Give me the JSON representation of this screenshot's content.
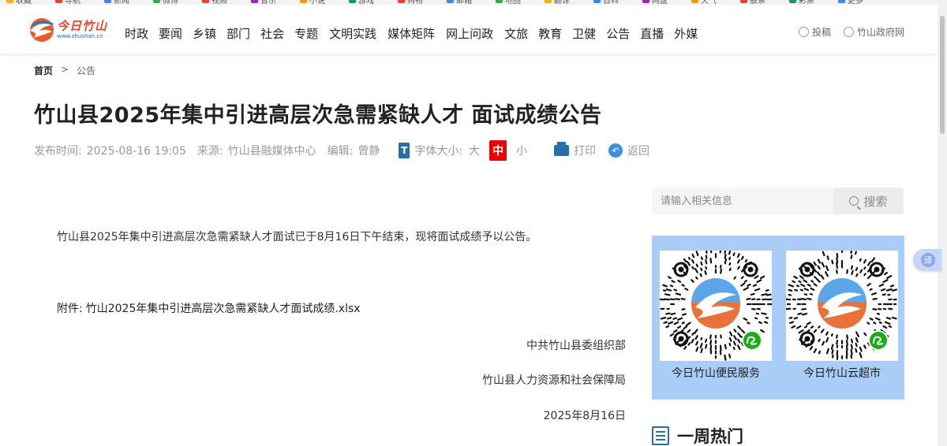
{
  "bookmarks": [
    "收藏",
    "导航",
    "新闻",
    "微博",
    "视频",
    "音乐",
    "小说",
    "游戏",
    "购物",
    "邮箱",
    "地图",
    "翻译",
    "百科",
    "网盘",
    "天气",
    "股票",
    "彩票",
    "更多"
  ],
  "header": {
    "logo_cn": "今日竹山",
    "logo_url": "www.zhushan.cn",
    "nav": [
      "时政",
      "要闻",
      "乡镇",
      "部门",
      "社会",
      "专题",
      "文明实践",
      "媒体矩阵",
      "网上问政",
      "文旅",
      "教育",
      "卫健",
      "公告",
      "直播",
      "外媒"
    ],
    "right_links": {
      "submit": "投稿",
      "gov": "竹山政府网"
    }
  },
  "breadcrumb": {
    "home": "首页",
    "sep": ">",
    "current": "公告"
  },
  "article": {
    "title": "竹山县2025年集中引进高层次急需紧缺人才 面试成绩公告",
    "publish_label": "发布时间:",
    "publish_time": "2025-08-16 19:05",
    "source_label": "来源:",
    "source": "竹山县融媒体中心",
    "editor_label": "编辑:",
    "editor": "曾静",
    "font_size_label": "字体大小:",
    "font_sizes": {
      "large": "大",
      "medium": "中",
      "small": "小"
    },
    "print": "打印",
    "back": "返回",
    "para1": "竹山县2025年集中引进高层次急需紧缺人才面试已于8月16日下午结束，现将面试成绩予以公告。",
    "attachment_label": "附件:",
    "attachment_name": "竹山2025年集中引进高层次急需紧缺人才面试成绩.xlsx",
    "sign1": "中共竹山县委组织部",
    "sign2": "竹山县人力资源和社会保障局",
    "sign_date": "2025年8月16日"
  },
  "sidebar": {
    "search_placeholder": "请输入相关信息",
    "search_button": "搜索",
    "qr_codes": [
      {
        "label": "今日竹山便民服务"
      },
      {
        "label": "今日竹山云超市"
      }
    ],
    "hot_title": "一周热门"
  },
  "translate": "译",
  "colors": {
    "accent_blue": "#2a6ea8",
    "active_red": "#e00000",
    "qr_panel": "#a9cdf7"
  }
}
